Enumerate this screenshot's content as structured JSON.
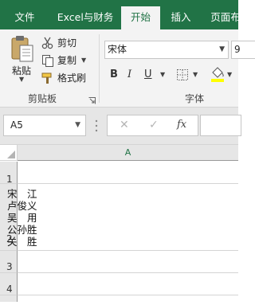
{
  "tabs": [
    {
      "label": "文件"
    },
    {
      "label": "Excel与财务"
    },
    {
      "label": "开始"
    },
    {
      "label": "插入"
    },
    {
      "label": "页面布"
    }
  ],
  "clipboard": {
    "paste": "粘贴",
    "cut": "剪切",
    "copy": "复制",
    "format_painter": "格式刷",
    "group_label": "剪贴板"
  },
  "font": {
    "name": "宋体",
    "size": "9",
    "bold": "B",
    "italic": "I",
    "underline": "U",
    "group_label": "字体"
  },
  "formula_bar": {
    "name_box": "A5",
    "cancel": "✕",
    "enter": "✓",
    "fx": "fx"
  },
  "sheet": {
    "column_header": "A",
    "rows": [
      "1",
      "2",
      "3",
      "4"
    ],
    "cell_a2": "宋　江\n卢俊义\n吴　用\n公孙胜\n关　胜"
  },
  "colors": {
    "accent": "#217346",
    "ribbon_bg": "#f3f3f3"
  }
}
